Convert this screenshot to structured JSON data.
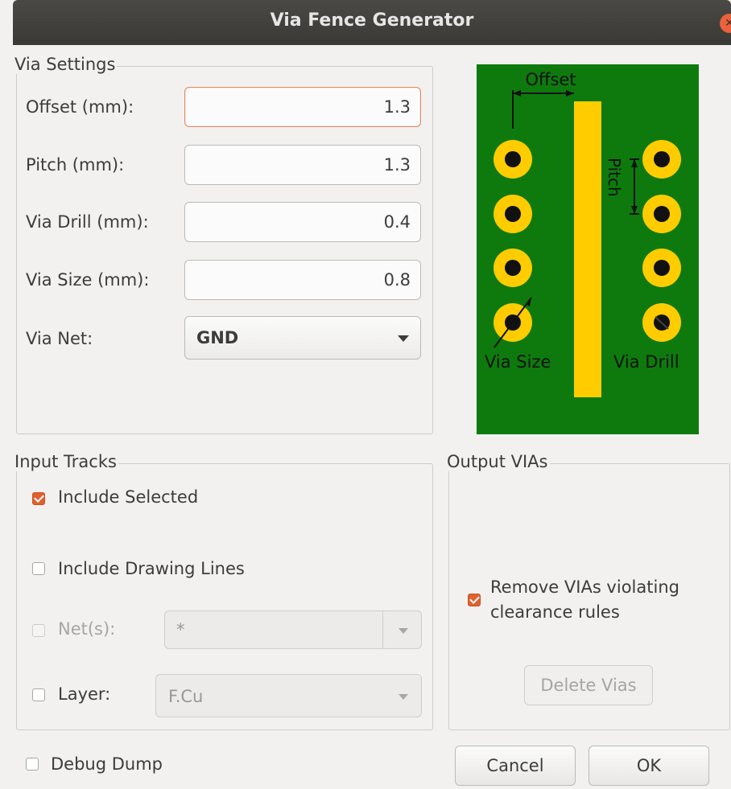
{
  "window": {
    "title": "Via Fence Generator"
  },
  "via_settings": {
    "group_label": "Via Settings",
    "offset": {
      "label": "Offset (mm):",
      "value": "1.3"
    },
    "pitch": {
      "label": "Pitch (mm):",
      "value": "1.3"
    },
    "via_drill": {
      "label": "Via Drill (mm):",
      "value": "0.4"
    },
    "via_size": {
      "label": "Via Size (mm):",
      "value": "0.8"
    },
    "via_net": {
      "label": "Via Net:",
      "value": "GND"
    }
  },
  "diagram": {
    "labels": {
      "offset": "Offset",
      "pitch": "Pitch",
      "via_size": "Via Size",
      "via_drill": "Via Drill"
    },
    "colors": {
      "board": "#0e7a0d",
      "copper": "#ffcc00",
      "drill": "#111111"
    }
  },
  "input_tracks": {
    "group_label": "Input Tracks",
    "include_selected": {
      "label": "Include Selected",
      "checked": true
    },
    "include_drawing_lines": {
      "label": "Include Drawing Lines",
      "checked": false
    },
    "nets": {
      "label": "Net(s):",
      "value": "*",
      "checked": false,
      "enabled": false
    },
    "layer": {
      "label": "Layer:",
      "value": "F.Cu",
      "checked": false
    }
  },
  "output_vias": {
    "group_label": "Output VIAs",
    "remove_violating": {
      "label_line1": "Remove VIAs violating",
      "label_line2": "clearance rules",
      "checked": true
    },
    "delete_button": "Delete Vias"
  },
  "footer": {
    "debug_dump": {
      "label": "Debug Dump",
      "checked": false
    },
    "cancel_button": "Cancel",
    "ok_button": "OK"
  }
}
